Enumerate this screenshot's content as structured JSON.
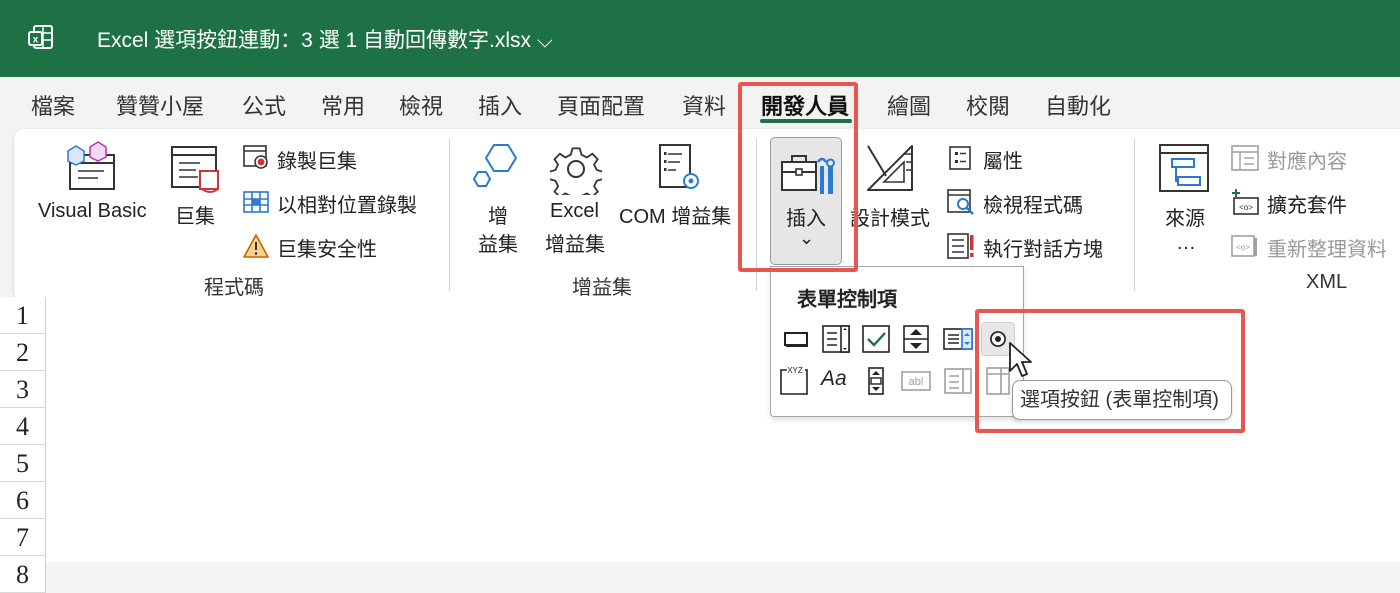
{
  "title_bar": {
    "doc_title": "Excel 選項按鈕連動：3 選 1 自動回傳數字.xlsx",
    "chevron": "⌵",
    "app_icon": "excel-icon",
    "color": "#1e7145"
  },
  "menu_tabs": [
    "檔案",
    "贊贊小屋",
    "公式",
    "常用",
    "檢視",
    "插入",
    "頁面配置",
    "資料",
    "開發人員",
    "繪圖",
    "校閱",
    "自動化"
  ],
  "active_tab": "開發人員",
  "ribbon": {
    "code_group": {
      "visual_basic": "Visual Basic",
      "macros": "巨集",
      "record_macro": "錄製巨集",
      "relative_record": "以相對位置錄製",
      "macro_security": "巨集安全性",
      "label": "程式碼"
    },
    "addins_group": {
      "addins_line1": "增",
      "addins_line2": "益集",
      "excel_addins_line1": "Excel",
      "excel_addins_line2": "增益集",
      "com_addins": "COM 增益集",
      "label": "增益集"
    },
    "controls_group": {
      "insert": "插入",
      "insert_chevron": "⌄",
      "design_mode": "設計模式",
      "properties": "屬性",
      "view_code": "檢視程式碼",
      "run_dialog": "執行對話方塊"
    },
    "xml_group": {
      "source_line1": "來源",
      "source_line2": "…",
      "map_properties": "對應內容",
      "expansion_packs": "擴充套件",
      "refresh_data": "重新整理資料",
      "label": "XML"
    }
  },
  "insert_dropdown": {
    "title": "表單控制項",
    "xyz_label": "XYZ",
    "label_ctl": "Aa",
    "textfield_label": "abl",
    "tooltip": "選項按鈕 (表單控制項)"
  },
  "rows": [
    "1",
    "2",
    "3",
    "4",
    "5",
    "6",
    "7",
    "8"
  ],
  "highlight_color": "#e8574f"
}
